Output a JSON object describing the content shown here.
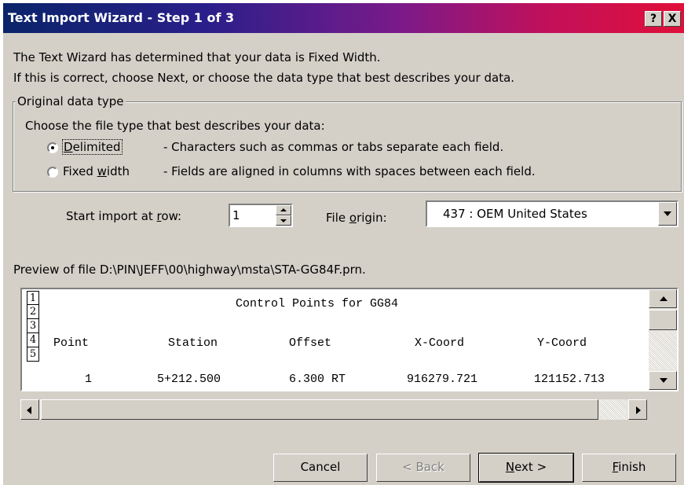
{
  "window": {
    "title": "Text Import Wizard - Step 1 of 3",
    "help_label": "?",
    "close_label": "X"
  },
  "intro": {
    "line1": "The Text Wizard has determined that your data is Fixed Width.",
    "line2": "If this is correct, choose Next, or choose the data type that best describes your data."
  },
  "data_type": {
    "group_label": "Original data type",
    "prompt": "Choose the file type that best describes your data:",
    "options": [
      {
        "label": "Delimited",
        "description": "- Characters such as commas or tabs separate each field.",
        "selected": true
      },
      {
        "label": "Fixed width",
        "description": "- Fields are aligned in columns with spaces between each field.",
        "selected": false
      }
    ]
  },
  "start_row": {
    "label": "Start import at row:",
    "value": "1"
  },
  "file_origin": {
    "label": "File origin:",
    "value": "437 : OEM United States"
  },
  "preview": {
    "label": "Preview of file D:\\PIN\\JEFF\\00\\highway\\msta\\STA-GG84F.prn.",
    "row_numbers": [
      "1",
      "2",
      "3",
      "4",
      "5"
    ],
    "title_line": "Control Points for GG84",
    "headers": [
      "Point",
      "Station",
      "Offset",
      "X-Coord",
      "Y-Coord"
    ],
    "row": [
      "1",
      "5+212.500",
      "6.300 RT",
      "916279.721",
      "121152.713"
    ]
  },
  "buttons": {
    "cancel": "Cancel",
    "back": "< Back",
    "next": "Next >",
    "finish": "Finish"
  }
}
